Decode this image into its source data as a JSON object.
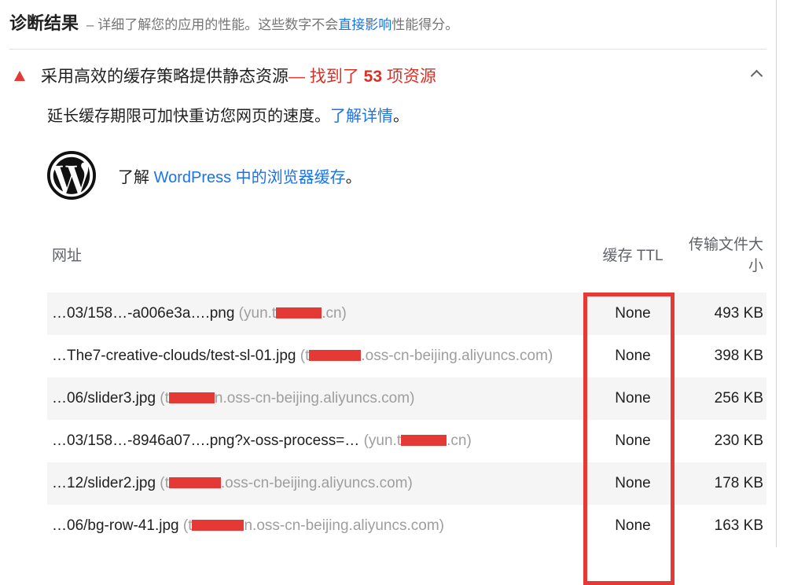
{
  "header": {
    "title": "诊断结果",
    "subtitle_prefix": "– 详细了解您的应用的性能。这些数字不会",
    "subtitle_link": "直接影响",
    "subtitle_suffix": "性能得分。"
  },
  "audit": {
    "title": "采用高效的缓存策略提供静态资源 ",
    "count_prefix": "— 找到了 ",
    "count_num": "53",
    "count_suffix": " 项资源",
    "description_prefix": "延长缓存期限可加快重访您网页的速度。",
    "description_link": "了解详情",
    "description_suffix": "。",
    "wp_prefix": "了解 ",
    "wp_link": "WordPress 中的浏览器缓存",
    "wp_suffix": "。"
  },
  "table": {
    "col_url": "网址",
    "col_ttl": "缓存 TTL",
    "col_size": "传输文件大小",
    "rows": [
      {
        "url_a": "…03/158…-a006e3a….png",
        "paren_a": "(yun.t",
        "redact_w": 58,
        "paren_b": ".cn)",
        "ttl": "None",
        "size": "493 KB"
      },
      {
        "url_a": "…The7-creative-clouds/test-sl-01.jpg",
        "paren_a": "(t",
        "redact_w": 66,
        "paren_b": ".oss-cn-beijing.aliyuncs.com)",
        "ttl": "None",
        "size": "398 KB"
      },
      {
        "url_a": "…06/slider3.jpg",
        "paren_a": "(t",
        "redact_w": 58,
        "paren_b": "n.oss-cn-beijing.aliyuncs.com)",
        "ttl": "None",
        "size": "256 KB"
      },
      {
        "url_a": "…03/158…-8946a07….png?x-oss-process=…",
        "paren_a": "(yun.t",
        "redact_w": 58,
        "paren_b": ".cn)",
        "ttl": "None",
        "size": "230 KB"
      },
      {
        "url_a": "…12/slider2.jpg",
        "paren_a": "(t",
        "redact_w": 66,
        "paren_b": ".oss-cn-beijing.aliyuncs.com)",
        "ttl": "None",
        "size": "178 KB"
      },
      {
        "url_a": "…06/bg-row-41.jpg",
        "paren_a": "(t",
        "redact_w": 66,
        "paren_b": "n.oss-cn-beijing.aliyuncs.com)",
        "ttl": "None",
        "size": "163 KB"
      }
    ]
  }
}
